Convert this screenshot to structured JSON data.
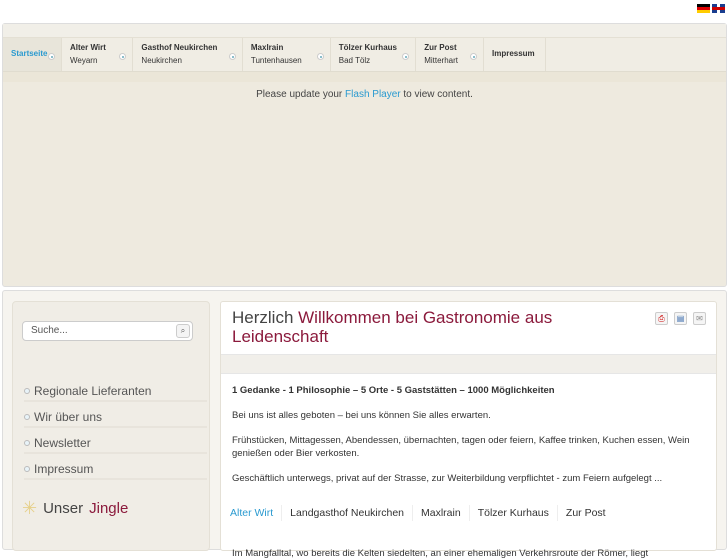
{
  "languages": [
    "Deutsch",
    "English"
  ],
  "nav": [
    {
      "title": "Startseite",
      "sub": ""
    },
    {
      "title": "Alter Wirt",
      "sub": "Weyarn"
    },
    {
      "title": "Gasthof Neukirchen",
      "sub": "Neukirchen"
    },
    {
      "title": "Maxlrain",
      "sub": "Tuntenhausen"
    },
    {
      "title": "Tölzer Kurhaus",
      "sub": "Bad Tölz"
    },
    {
      "title": "Zur Post",
      "sub": "Mitterhart"
    },
    {
      "title": "Impressum",
      "sub": ""
    }
  ],
  "flash": {
    "before": "Please update your ",
    "link": "Flash Player",
    "after": " to view content."
  },
  "search": {
    "placeholder": "Suche..."
  },
  "sidebar": {
    "items": [
      "Regionale Lieferanten",
      "Wir über uns",
      "Newsletter",
      "Impressum"
    ],
    "jingle_a": "Unser",
    "jingle_b": "Jingle"
  },
  "article": {
    "title_a": "Herzlich ",
    "title_b": "Willkommen bei Gastronomie aus Leidenschaft",
    "icons": [
      "pdf-icon",
      "print-icon",
      "email-icon"
    ],
    "p1": "1 Gedanke - 1 Philosophie – 5 Orte - 5 Gaststätten – 1000 Möglichkeiten",
    "p2": "Bei uns ist alles geboten – bei uns können Sie alles erwarten.",
    "p3": "Frühstücken, Mittagessen, Abendessen, übernachten, tagen oder feiern, Kaffee trinken, Kuchen essen, Wein genießen oder Bier verkosten.",
    "p4": "Geschäftlich unterwegs, privat auf der Strasse, zur Weiterbildung verpflichtet - zum Feiern aufgelegt ...",
    "tabs": [
      "Alter Wirt",
      "Landgasthof Neukirchen",
      "Maxlrain",
      "Tölzer Kurhaus",
      "Zur Post"
    ],
    "cut": "Im Mangfalltal, wo bereits die Kelten siedelten, an einer ehemaligen Verkehrsroute der Römer, liegt"
  },
  "colors": {
    "accent": "#2a9ad0",
    "brand": "#8b1a3c"
  }
}
